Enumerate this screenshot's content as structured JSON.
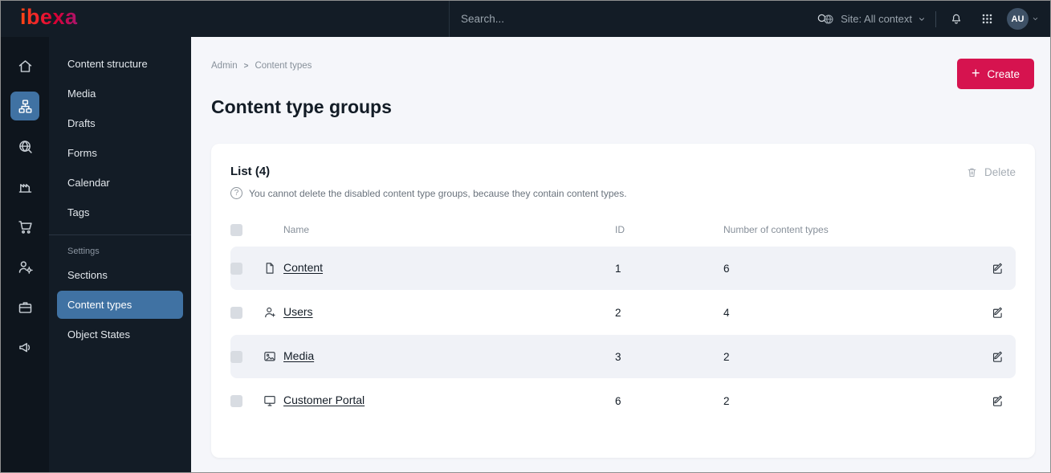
{
  "topbar": {
    "logo_text": "ibexa",
    "search_placeholder": "Search...",
    "site_context_label": "Site: All context",
    "avatar_initials": "AU"
  },
  "rail": {
    "items": [
      {
        "icon": "home-icon"
      },
      {
        "icon": "content-structure-icon",
        "active": true
      },
      {
        "icon": "site-search-icon"
      },
      {
        "icon": "product-catalog-icon"
      },
      {
        "icon": "commerce-cart-icon"
      },
      {
        "icon": "personalization-icon"
      },
      {
        "icon": "admin-toolbox-icon"
      },
      {
        "icon": "marketing-megaphone-icon"
      }
    ]
  },
  "sidebar": {
    "items": [
      {
        "label": "Content structure"
      },
      {
        "label": "Media"
      },
      {
        "label": "Drafts"
      },
      {
        "label": "Forms"
      },
      {
        "label": "Calendar"
      },
      {
        "label": "Tags"
      }
    ],
    "settings_heading": "Settings",
    "settings_items": [
      {
        "label": "Sections"
      },
      {
        "label": "Content types",
        "active": true
      },
      {
        "label": "Object States"
      }
    ]
  },
  "main": {
    "breadcrumb": {
      "items": [
        "Admin",
        "Content types"
      ],
      "separator": ">"
    },
    "create_button": "Create",
    "page_title": "Content type groups",
    "card": {
      "list_title": "List (4)",
      "help_text": "You cannot delete the disabled content type groups, because they contain content types.",
      "delete_button": "Delete",
      "table": {
        "columns": [
          "Name",
          "ID",
          "Number of content types"
        ],
        "rows": [
          {
            "icon": "content-file-icon",
            "name": "Content",
            "id": "1",
            "count": "6"
          },
          {
            "icon": "users-icon",
            "name": "Users",
            "id": "2",
            "count": "4"
          },
          {
            "icon": "media-image-icon",
            "name": "Media",
            "id": "3",
            "count": "2"
          },
          {
            "icon": "customer-portal-icon",
            "name": "Customer Portal",
            "id": "6",
            "count": "2"
          }
        ]
      }
    }
  },
  "colors": {
    "brand_accent": "#d6134f",
    "topbar_bg": "#131c26",
    "active_item_bg": "#4072a3",
    "row_stripe": "#f0f2f7"
  }
}
